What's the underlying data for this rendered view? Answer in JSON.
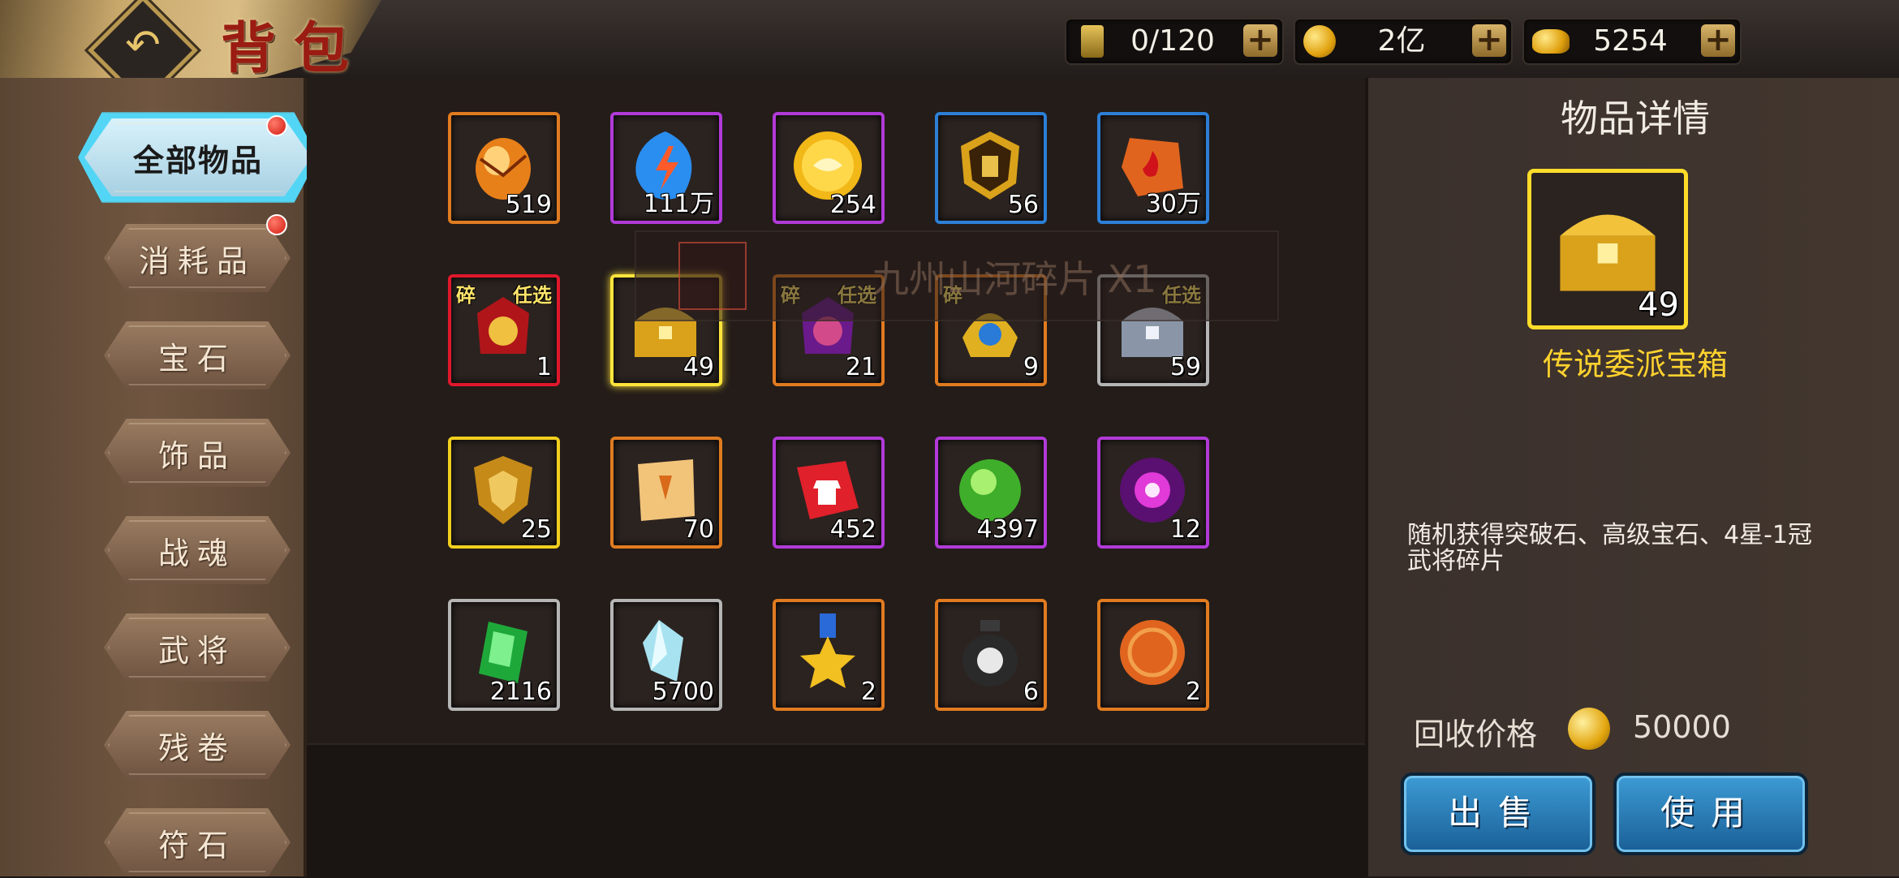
{
  "header": {
    "title": "背包",
    "resources": [
      {
        "icon": "flag-icon",
        "value": "0/120"
      },
      {
        "icon": "gold-coin-icon",
        "value": "2亿"
      },
      {
        "icon": "gold-ingot-icon",
        "value": "5254"
      }
    ],
    "plus_label": "+"
  },
  "sidebar": {
    "items": [
      {
        "label": "全部物品",
        "active": true,
        "badge": true
      },
      {
        "label": "消耗品",
        "badge": true
      },
      {
        "label": "宝石"
      },
      {
        "label": "饰品"
      },
      {
        "label": "战魂"
      },
      {
        "label": "武将"
      },
      {
        "label": "残卷"
      },
      {
        "label": "符石"
      }
    ]
  },
  "inventory": {
    "rows": [
      [
        {
          "name": "fire-egg",
          "count": "519",
          "rarity": "orange"
        },
        {
          "name": "lightning-gem",
          "count": "111万",
          "rarity": "purple"
        },
        {
          "name": "gold-coin",
          "count": "254",
          "rarity": "purple"
        },
        {
          "name": "gold-token",
          "count": "56",
          "rarity": "blue"
        },
        {
          "name": "fire-stone",
          "count": "30万",
          "rarity": "blue"
        }
      ],
      [
        {
          "name": "red-general-fragment",
          "count": "1",
          "rarity": "red",
          "tag_left": "碎",
          "tag_right": "任选"
        },
        {
          "name": "legendary-chest",
          "count": "49",
          "rarity": "yellow",
          "selected": true
        },
        {
          "name": "purple-general-fragment",
          "count": "21",
          "rarity": "orange",
          "tag_left": "碎",
          "tag_right": "任选"
        },
        {
          "name": "blue-helmet-fragment",
          "count": "9",
          "rarity": "orange",
          "tag_left": "碎"
        },
        {
          "name": "silver-chest",
          "count": "59",
          "rarity": "grey",
          "tag_right": "任选"
        }
      ],
      [
        {
          "name": "gold-shield",
          "count": "25",
          "rarity": "yellow"
        },
        {
          "name": "scroll",
          "count": "70",
          "rarity": "orange"
        },
        {
          "name": "armor-puzzle",
          "count": "452",
          "rarity": "purple"
        },
        {
          "name": "green-orb",
          "count": "4397",
          "rarity": "purple"
        },
        {
          "name": "pink-energy-orb",
          "count": "12",
          "rarity": "purple"
        }
      ],
      [
        {
          "name": "green-gem",
          "count": "2116",
          "rarity": "grey"
        },
        {
          "name": "ice-crystal",
          "count": "5700",
          "rarity": "grey"
        },
        {
          "name": "gold-medal",
          "count": "2",
          "rarity": "orange"
        },
        {
          "name": "wine-jar",
          "count": "6",
          "rarity": "orange"
        },
        {
          "name": "orange-seal",
          "count": "2",
          "rarity": "orange"
        }
      ]
    ]
  },
  "tooltip": {
    "text": "九州山河碎片 X1"
  },
  "detail": {
    "title": "物品详情",
    "item_name": "传说委派宝箱",
    "item_count": "49",
    "description": "随机获得突破石、高级宝石、4星-1冠武将碎片",
    "price_label": "回收价格",
    "price_value": "50000",
    "sell_label": "出售",
    "use_label": "使用"
  },
  "colors": {
    "orange": "#e07b20",
    "purple": "#b13ad8",
    "blue": "#2d7fd6",
    "red": "#e0182b",
    "yellow": "#f1cf1e",
    "grey": "#b5b5b5",
    "accent_cyan": "#53d6f5"
  }
}
